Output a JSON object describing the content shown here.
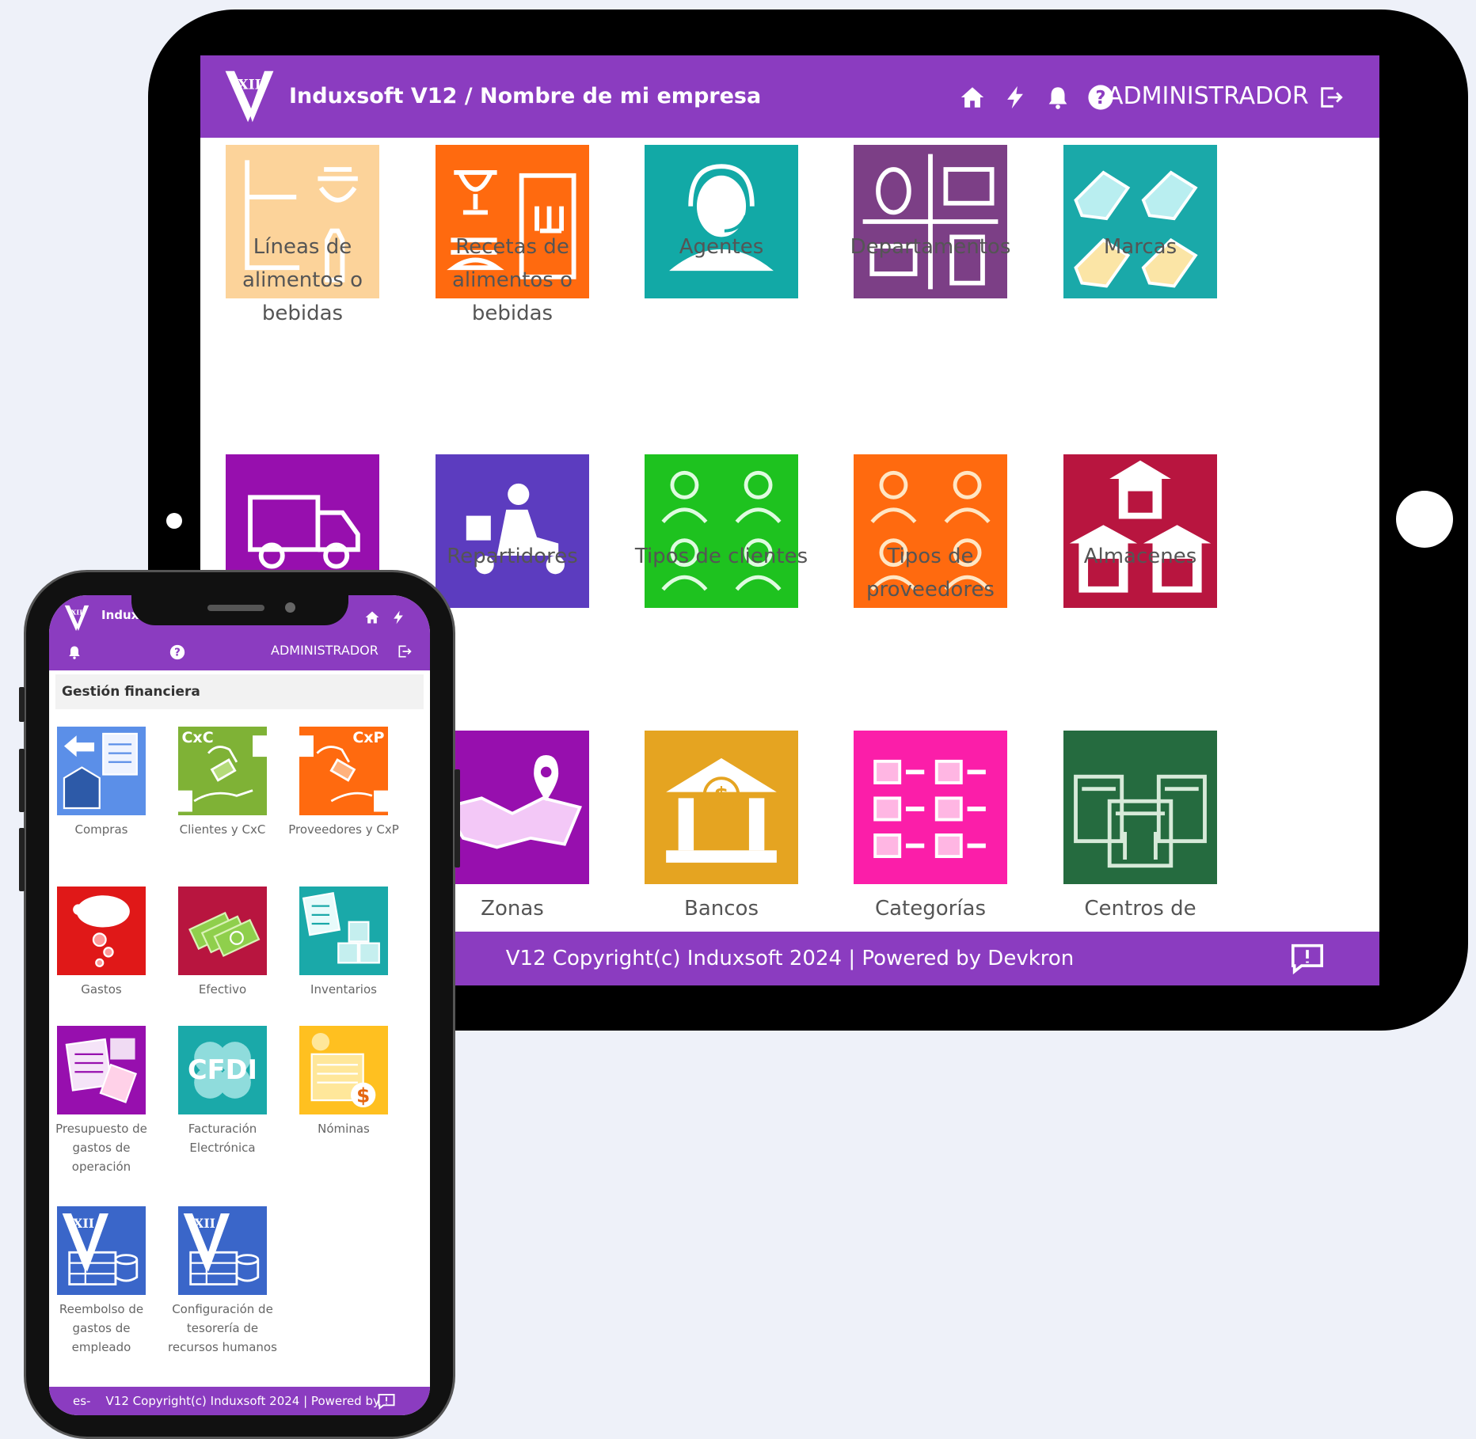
{
  "colors": {
    "brand_purple": "#8b3cc0",
    "device_frame": "#000000",
    "page_background": "#eef1f9"
  },
  "tablet": {
    "header": {
      "title": "Induxsoft V12 / Nombre de mi empresa",
      "user": "ADMINISTRADOR",
      "icons": [
        "home-icon",
        "lightning-icon",
        "bell-icon",
        "help-icon",
        "logout-icon"
      ]
    },
    "tiles": [
      {
        "label": "Líneas de alimentos o bebidas",
        "icon": "food-lines-icon",
        "color": "#fcd39a"
      },
      {
        "label": "Recetas de alimentos o bebidas",
        "icon": "recipe-book-icon",
        "color": "#ff6a0f"
      },
      {
        "label": "Agentes",
        "icon": "agent-headset-icon",
        "color": "#12a9a6"
      },
      {
        "label": "Departamentos",
        "icon": "departments-icon",
        "color": "#7c3f86"
      },
      {
        "label": "Marcas",
        "icon": "tags-icon",
        "color": "#1aa9a9"
      },
      {
        "label": "",
        "icon": "truck-icon",
        "color": "#970fae"
      },
      {
        "label": "Repartidores",
        "icon": "delivery-scooter-icon",
        "color": "#5c3cbf"
      },
      {
        "label": "Tipos de clientes",
        "icon": "client-types-icon",
        "color": "#1ec21f"
      },
      {
        "label": "Tipos de proveedores",
        "icon": "supplier-types-icon",
        "color": "#ff6a0f"
      },
      {
        "label": "Almacenes",
        "icon": "warehouses-icon",
        "color": "#b8153f"
      },
      {
        "label": "Zonas",
        "icon": "map-zones-icon",
        "color": "#970fae"
      },
      {
        "label": "Bancos",
        "icon": "bank-icon",
        "color": "#e5a421"
      },
      {
        "label": "Categorías",
        "icon": "categories-icon",
        "color": "#fb1ea9"
      },
      {
        "label": "Centros de",
        "icon": "buildings-icon",
        "color": "#256b3f"
      }
    ],
    "footer": {
      "copyright": "V12 Copyright(c) Induxsoft 2024 | Powered by Devkron"
    }
  },
  "phone": {
    "header": {
      "title": "Induxs",
      "user": "ADMINISTRADOR"
    },
    "section_title": "Gestión financiera",
    "tiles": [
      {
        "label": "Compras",
        "icon": "purchases-icon",
        "color": "#5b8fe8"
      },
      {
        "label": "Clientes y CxC",
        "icon": "accounts-receivable-icon",
        "color": "#7fb236",
        "badge": "CxC"
      },
      {
        "label": "Proveedores y CxP",
        "icon": "accounts-payable-icon",
        "color": "#ff6a0f",
        "badge": "CxP"
      },
      {
        "label": "Gastos",
        "icon": "piggy-bank-icon",
        "color": "#e01818"
      },
      {
        "label": "Efectivo",
        "icon": "cash-icon",
        "color": "#b8153f"
      },
      {
        "label": "Inventarios",
        "icon": "inventory-icon",
        "color": "#1aa9a9"
      },
      {
        "label": "Presupuesto de gastos de operación",
        "icon": "budget-icon",
        "color": "#970fae"
      },
      {
        "label": "Facturación Electrónica",
        "icon": "cfdi-icon",
        "color": "#1aa9a9",
        "badge": "CFDI"
      },
      {
        "label": "Nóminas",
        "icon": "payroll-icon",
        "color": "#ffc020"
      },
      {
        "label": "Reembolso de gastos de empleado",
        "icon": "reimbursement-icon",
        "color": "#3a66c9",
        "badge": "XII"
      },
      {
        "label": "Configuración de tesorería de recursos humanos",
        "icon": "treasury-config-icon",
        "color": "#3a66c9",
        "badge": "XII"
      }
    ],
    "footer": {
      "lang": "es-",
      "copyright": "V12 Copyright(c) Induxsoft 2024 | Powered by"
    }
  }
}
